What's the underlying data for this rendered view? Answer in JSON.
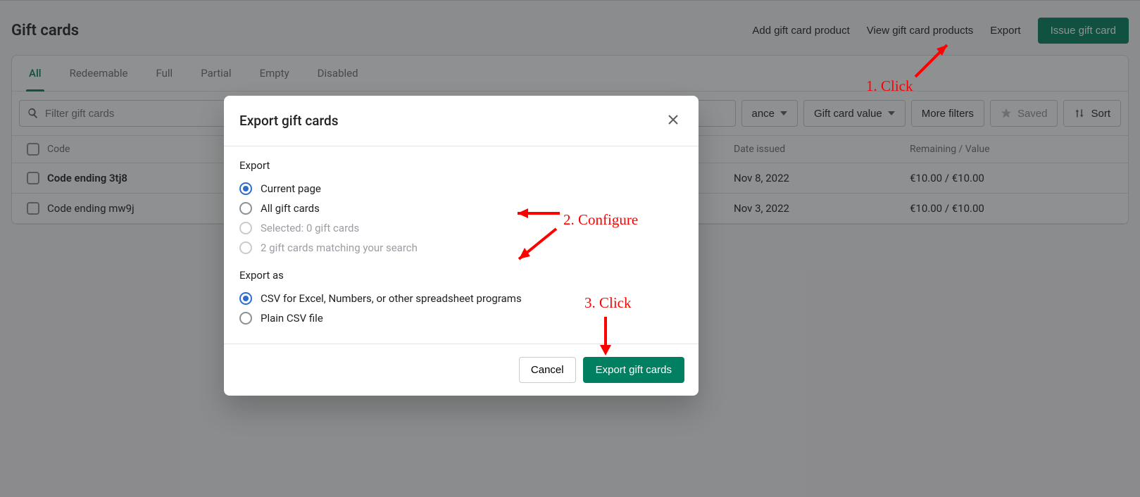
{
  "header": {
    "title": "Gift cards",
    "add_product": "Add gift card product",
    "view_products": "View gift card products",
    "export": "Export",
    "issue": "Issue gift card"
  },
  "tabs": {
    "all": "All",
    "redeemable": "Redeemable",
    "full": "Full",
    "partial": "Partial",
    "empty": "Empty",
    "disabled": "Disabled"
  },
  "toolbar": {
    "search_placeholder": "Filter gift cards",
    "balance": "ance",
    "value": "Gift card value",
    "more": "More filters",
    "saved": "Saved",
    "sort": "Sort"
  },
  "columns": {
    "code": "Code",
    "date": "Date issued",
    "value": "Remaining / Value"
  },
  "rows": [
    {
      "code": "Code ending 3tj8",
      "date": "Nov 8, 2022",
      "value": "€10.00 / €10.00",
      "bold": true
    },
    {
      "code": "Code ending mw9j",
      "date": "Nov 3, 2022",
      "value": "€10.00 / €10.00",
      "bold": false
    }
  ],
  "modal": {
    "title": "Export gift cards",
    "section_export": "Export",
    "opt_current": "Current page",
    "opt_all": "All gift cards",
    "opt_selected": "Selected: 0 gift cards",
    "opt_matching": "2 gift cards matching your search",
    "section_as": "Export as",
    "opt_csv_excel": "CSV for Excel, Numbers, or other spreadsheet programs",
    "opt_plain": "Plain CSV file",
    "cancel": "Cancel",
    "confirm": "Export gift cards"
  },
  "anno": {
    "a1": "1. Click",
    "a2": "2. Configure",
    "a3": "3. Click"
  }
}
